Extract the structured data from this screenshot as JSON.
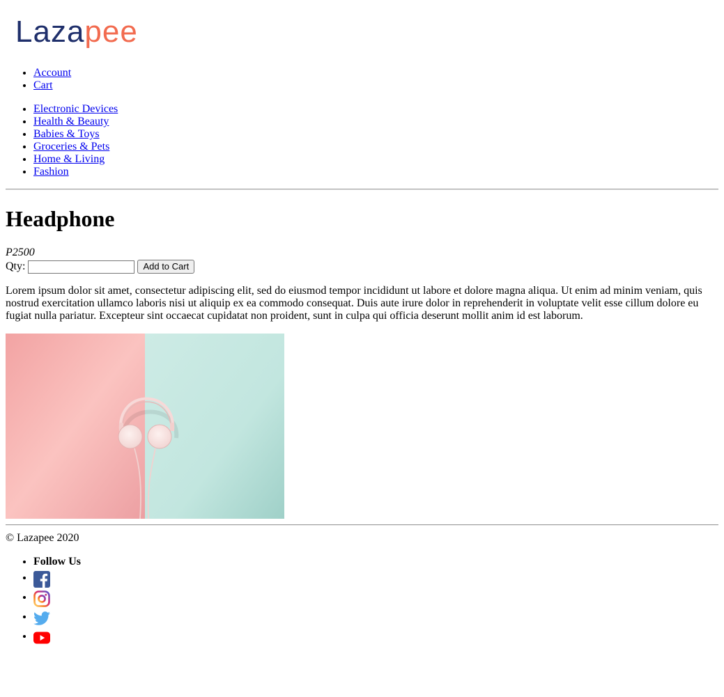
{
  "header": {
    "logo_text": "Lazapee",
    "account_nav": [
      {
        "label": "Account"
      },
      {
        "label": "Cart"
      }
    ],
    "categories": [
      {
        "label": "Electronic Devices"
      },
      {
        "label": "Health & Beauty"
      },
      {
        "label": "Babies & Toys"
      },
      {
        "label": "Groceries & Pets"
      },
      {
        "label": "Home & Living"
      },
      {
        "label": "Fashion"
      }
    ]
  },
  "product": {
    "title": "Headphone",
    "price": "P2500",
    "qty_label": "Qty:",
    "qty_value": "",
    "add_to_cart_label": "Add to Cart",
    "description": "Lorem ipsum dolor sit amet, consectetur adipiscing elit, sed do eiusmod tempor incididunt ut labore et dolore magna aliqua. Ut enim ad minim veniam, quis nostrud exercitation ullamco laboris nisi ut aliquip ex ea commodo consequat. Duis aute irure dolor in reprehenderit in voluptate velit esse cillum dolore eu fugiat nulla pariatur. Excepteur sint occaecat cupidatat non proident, sunt in culpa qui officia deserunt mollit anim id est laborum.",
    "image_icon": "headphone-image"
  },
  "footer": {
    "copyright": "© Lazapee 2020",
    "follow_label": "Follow Us",
    "social": [
      {
        "icon": "facebook-icon",
        "color": "#3b5998"
      },
      {
        "icon": "instagram-icon",
        "color": "#c13584"
      },
      {
        "icon": "twitter-icon",
        "color": "#55acee"
      },
      {
        "icon": "youtube-icon",
        "color": "#ff0000"
      }
    ]
  },
  "colors": {
    "logo_blue": "#1f2f6b",
    "logo_orange": "#f26b4f",
    "link": "#0000ee"
  }
}
